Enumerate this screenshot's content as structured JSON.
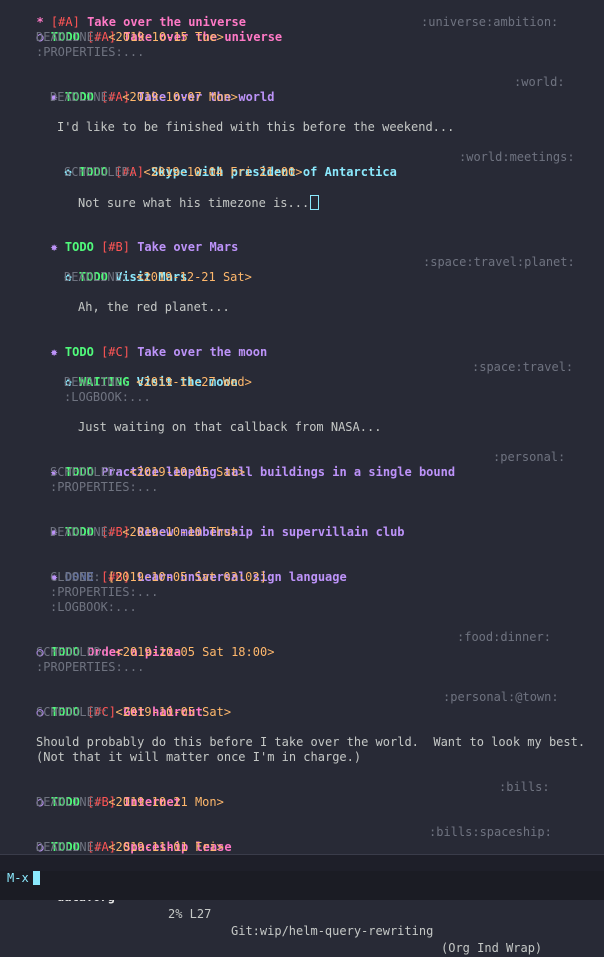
{
  "colors": {
    "background": "#282a36",
    "todo": "#50fa7b",
    "priority": "#ff5555",
    "level1": "#ff79c6",
    "level2": "#bd93f9",
    "level3": "#8be9fd",
    "date": "#ffb86c",
    "meta": "#6f7380"
  },
  "icons": {
    "level1_bullet": "◉-icon",
    "level2_bullet": "○-icon",
    "level3_bullet": "✸-icon",
    "level4_bullet": "✿-icon"
  },
  "glyphs": {
    "b1": "*",
    "b2": "○",
    "b3": "✸",
    "b4": "✿"
  },
  "outline": {
    "root": {
      "priority": "[#A]",
      "title": "Take over the universe"
    },
    "universe": {
      "keyword": "TODO",
      "priority": "[#A]",
      "title": "Take over the universe",
      "tags": ":universe:ambition:",
      "deadline_label": "DEADLINE:",
      "deadline": "<2019-10-15 Tue>",
      "properties": ":PROPERTIES:..."
    },
    "world": {
      "keyword": "TODO",
      "priority": "[#A]",
      "title": "Take over the world",
      "tags": ":world:",
      "deadline_label": "DEADLINE:",
      "deadline": "<2019-10-07 Mon>",
      "body": "I'd like to be finished with this before the weekend..."
    },
    "skype": {
      "keyword": "TODO",
      "priority": "[#A]",
      "title": "Skype with president of Antarctica",
      "tags": ":world:meetings:",
      "scheduled_label": "SCHEDULED:",
      "scheduled": "<2019-10-04 Fri 21:00>",
      "body": "Not sure what his timezone is..."
    },
    "mars": {
      "keyword": "TODO",
      "priority": "[#B]",
      "title": "Take over Mars"
    },
    "visit_mars": {
      "keyword": "TODO",
      "title": "Visit Mars",
      "tags": ":space:travel:planet:",
      "deadline_label": "DEADLINE:",
      "deadline": "<2019-12-21 Sat>",
      "body": "Ah, the red planet..."
    },
    "moon": {
      "keyword": "TODO",
      "priority": "[#C]",
      "title": "Take over the moon"
    },
    "visit_moon": {
      "keyword": "WAITING",
      "title": "Visit the moon",
      "tags": ":space:travel:",
      "deadline_label": "DEADLINE:",
      "deadline": "<2019-11-27 Wed>",
      "logbook": ":LOGBOOK:...",
      "body": "Just waiting on that callback from NASA..."
    },
    "leaping": {
      "keyword": "TODO",
      "title": "Practice leaping tall buildings in a single bound",
      "tags": ":personal:",
      "scheduled_label": "SCHEDULED:",
      "scheduled": "<2019-10-05 Sat>",
      "properties": ":PROPERTIES:..."
    },
    "renew": {
      "keyword": "TODO",
      "priority": "[#B]",
      "title": "Renew membership in supervillain club",
      "deadline_label": "DEADLINE:",
      "deadline": "<2019-10-10 Thu>"
    },
    "sign": {
      "keyword": "DONE",
      "priority": "[#B]",
      "title": "Learn universal sign language",
      "closed_label": "CLOSED:",
      "closed": "[2019-10-05 Sat 03:02]",
      "properties": ":PROPERTIES:...",
      "logbook": ":LOGBOOK:..."
    },
    "pizza": {
      "keyword": "TODO",
      "title": "Order a pizza",
      "tags": ":food:dinner:",
      "scheduled_label": "SCHEDULED:",
      "scheduled": "<2019-10-05 Sat 18:00>",
      "properties": ":PROPERTIES:..."
    },
    "haircut": {
      "keyword": "TODO",
      "priority": "[#C]",
      "title": "Get haircut",
      "tags": ":personal:@town:",
      "scheduled_label": "SCHEDULED:",
      "scheduled": "<2019-10-05 Sat>",
      "body1": "Should probably do this before I take over the world.  Want to look my best.",
      "body2": "(Not that it will matter once I'm in charge.)"
    },
    "internet": {
      "keyword": "TODO",
      "priority": "[#B]",
      "title": "Internet",
      "tags": ":bills:",
      "deadline_label": "DEADLINE:",
      "deadline": "<2019-10-21 Mon>"
    },
    "spaceship": {
      "keyword": "TODO",
      "priority": "[#A]",
      "title": "Spaceship lease",
      "tags": ":bills:spaceship:",
      "deadline_label": "DEADLINE:",
      "deadline": "<2019-11-01 Fri>"
    }
  },
  "modeline": {
    "status": "-:**-",
    "buffer": "data.org",
    "position": "2% L27",
    "vc": "Git:wip/helm-query-rewriting",
    "modes": "(Org Ind Wrap)"
  },
  "minibuffer": {
    "prompt": "M-x"
  }
}
